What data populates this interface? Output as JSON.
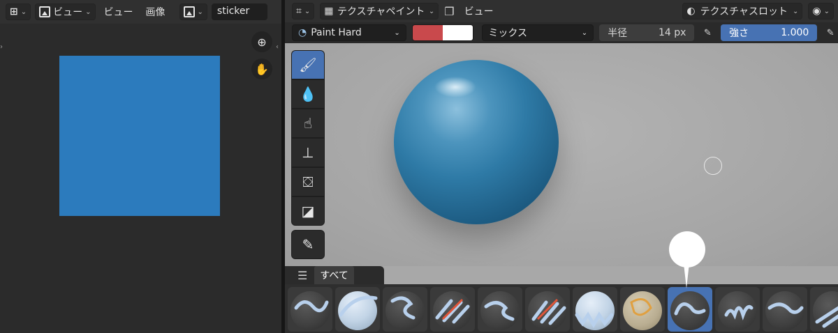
{
  "image_editor": {
    "header": {
      "editor_type_icon": "image-editor-icon",
      "view_menu": "ビュー",
      "view_label": "ビュー",
      "image_menu": "画像",
      "image_name": "sticker"
    },
    "canvas_color": "#2c7bbd",
    "tools": {
      "zoom_icon": "zoom-icon",
      "pan_icon": "hand-icon"
    }
  },
  "viewport": {
    "header": {
      "mode": "テクスチャペイント",
      "view_menu": "ビュー",
      "texture_slot": "テクスチャスロット"
    },
    "tool_settings": {
      "brush_name": "Paint Hard",
      "color_primary": "#c9494c",
      "color_secondary": "#ffffff",
      "blend_mode": "ミックス",
      "radius_label": "半径",
      "radius_value": "14 px",
      "strength_label": "強さ",
      "strength_value": "1.000"
    },
    "toolbar": [
      {
        "name": "brush-icon",
        "glyph": "🖌"
      },
      {
        "name": "blur-icon",
        "glyph": "💧"
      },
      {
        "name": "smear-icon",
        "glyph": "✋"
      },
      {
        "name": "clone-icon",
        "glyph": "⊥"
      },
      {
        "name": "fill-icon",
        "glyph": "⛋"
      },
      {
        "name": "mask-icon",
        "glyph": "◪"
      }
    ],
    "annotate_tool": {
      "name": "annotate-icon",
      "glyph": "✎"
    },
    "asset_shelf": {
      "tab_label": "すべて",
      "brush_count": 12,
      "active_index": 8
    }
  }
}
